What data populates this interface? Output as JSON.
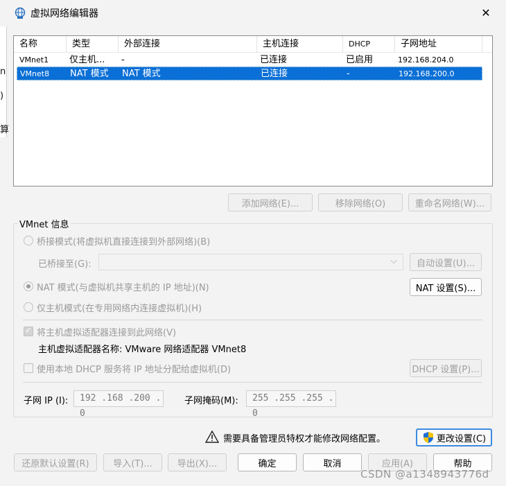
{
  "window": {
    "title": "虚拟网络编辑器",
    "close_glyph": "✕"
  },
  "background_fragments": [
    "n",
    ")",
    "算"
  ],
  "table": {
    "columns": [
      "名称",
      "类型",
      "外部连接",
      "主机连接",
      "DHCP",
      "子网地址"
    ],
    "rows": [
      {
        "name": "VMnet1",
        "type": "仅主机...",
        "external": "-",
        "host": "已连接",
        "dhcp": "已启用",
        "subnet": "192.168.204.0",
        "selected": false
      },
      {
        "name": "VMnet8",
        "type": "NAT 模式",
        "external": "NAT 模式",
        "host": "已连接",
        "dhcp": "-",
        "subnet": "192.168.200.0",
        "selected": true
      }
    ]
  },
  "list_buttons": {
    "add": "添加网络(E)...",
    "remove": "移除网络(O)",
    "rename": "重命名网络(W)..."
  },
  "vmnet_info": {
    "group_title": "VMnet 信息",
    "bridge_mode": "桥接模式(将虚拟机直接连接到外部网络)(B)",
    "bridged_to_label": "已桥接至(G):",
    "bridged_to_value": "",
    "auto_settings": "自动设置(U)...",
    "nat_mode": "NAT 模式(与虚拟机共享主机的 IP 地址)(N)",
    "nat_settings": "NAT 设置(S)...",
    "host_only": "仅主机模式(在专用网络内连接虚拟机)(H)",
    "connect_adapter": "将主机虚拟适配器连接到此网络(V)",
    "adapter_name": "主机虚拟适配器名称: VMware 网络适配器 VMnet8",
    "use_dhcp": "使用本地 DHCP 服务将 IP 地址分配给虚拟机(D)",
    "dhcp_settings": "DHCP 设置(P)...",
    "subnet_ip_label": "子网 IP (I):",
    "subnet_ip_value": "192 .168 .200 . 0",
    "subnet_mask_label": "子网掩码(M):",
    "subnet_mask_value": "255 .255 .255 . 0",
    "selected_mode": "nat"
  },
  "admin_notice": {
    "text": "需要具备管理员特权才能修改网络配置。",
    "change_settings": "更改设置(C)"
  },
  "footer": {
    "restore": "还原默认设置(R)",
    "import": "导入(T)...",
    "export": "导出(X)...",
    "ok": "确定",
    "cancel": "取消",
    "apply": "应用(A)",
    "help": "帮助"
  },
  "watermark": "CSDN @a1348943776d",
  "colors": {
    "selection": "#0a6fd6",
    "accent": "#2c7be5",
    "shield_blue": "#1e6fd6",
    "shield_yellow": "#f5c400"
  }
}
